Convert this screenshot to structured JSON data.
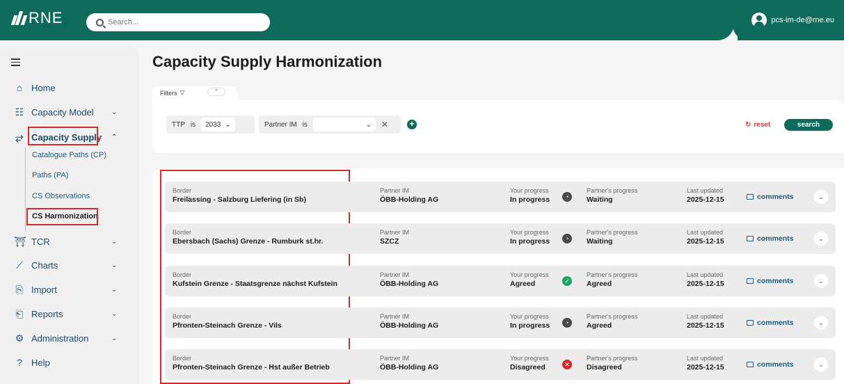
{
  "header": {
    "logo_text": "RNE",
    "search_placeholder": "Search...",
    "user_email": "pcs-im-de@rne.eu"
  },
  "sidebar": {
    "items": [
      {
        "label": "Home",
        "icon": "home-icon"
      },
      {
        "label": "Capacity Model",
        "icon": "capacity-model-icon"
      },
      {
        "label": "Capacity Supply",
        "icon": "capacity-supply-icon"
      },
      {
        "label": "TCR",
        "icon": "tcr-icon"
      },
      {
        "label": "Charts",
        "icon": "chart-icon"
      },
      {
        "label": "Import",
        "icon": "import-icon"
      },
      {
        "label": "Reports",
        "icon": "reports-icon"
      },
      {
        "label": "Administration",
        "icon": "administration-icon"
      },
      {
        "label": "Help",
        "icon": "help-icon"
      }
    ],
    "sub_items": [
      {
        "label": "Catalogue Paths (CP)"
      },
      {
        "label": "Paths (PA)"
      },
      {
        "label": "CS Observations"
      },
      {
        "label": "CS Harmonization"
      }
    ]
  },
  "main": {
    "title": "Capacity Supply Harmonization",
    "filters_label": "Filters",
    "filter_chips": {
      "ttp_label": "TTP",
      "ttp_op": "is",
      "ttp_value": "2033",
      "partner_label": "Partner IM",
      "partner_op": "is",
      "partner_value": ""
    },
    "reset_label": "reset",
    "search_label": "search",
    "columns": {
      "border": "Border",
      "partner": "Partner IM",
      "your_progress": "Your progress",
      "partner_progress": "Partner's progress",
      "last_updated": "Last updated",
      "comments": "comments"
    },
    "rows": [
      {
        "border": "Freilassing - Salzburg Liefering (in Sb)",
        "partner": "ÖBB-Holding AG",
        "your_progress": "In progress",
        "status": "progress",
        "partner_progress": "Waiting",
        "last_updated": "2025-12-15"
      },
      {
        "border": "Ebersbach (Sachs) Grenze - Rumburk st.hr.",
        "partner": "SZCZ",
        "your_progress": "In progress",
        "status": "progress",
        "partner_progress": "Waiting",
        "last_updated": "2025-12-15"
      },
      {
        "border": "Kufstein Grenze - Staatsgrenze nächst Kufstein",
        "partner": "ÖBB-Holding AG",
        "your_progress": "Agreed",
        "status": "agreed",
        "partner_progress": "Agreed",
        "last_updated": "2025-12-15"
      },
      {
        "border": "Pfronten-Steinach Grenze - Vils",
        "partner": "ÖBB-Holding AG",
        "your_progress": "In progress",
        "status": "progress",
        "partner_progress": "Agreed",
        "last_updated": "2025-12-15"
      },
      {
        "border": "Pfronten-Steinach Grenze - Hst außer Betrieb",
        "partner": "ÖBB-Holding AG",
        "your_progress": "Disagreed",
        "status": "disagreed",
        "partner_progress": "Disagreed",
        "last_updated": "2025-12-15"
      }
    ]
  }
}
